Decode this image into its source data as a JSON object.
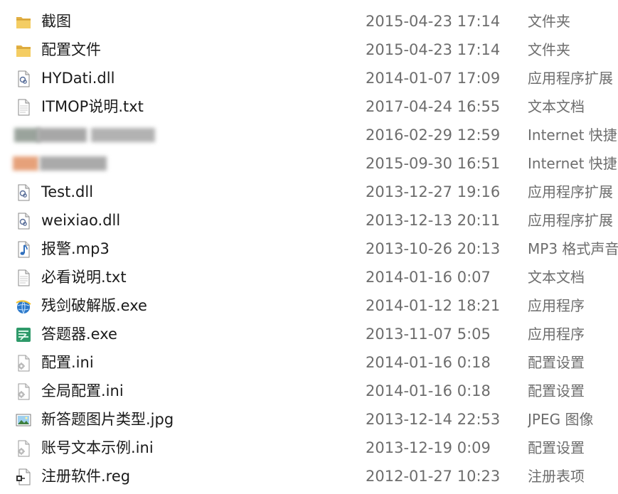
{
  "files": [
    {
      "icon": "folder-icon",
      "name": "截图",
      "date": "2015-04-23 17:14",
      "type": "文件夹"
    },
    {
      "icon": "folder-icon",
      "name": "配置文件",
      "date": "2015-04-23 17:14",
      "type": "文件夹"
    },
    {
      "icon": "dll-file-icon",
      "name": "HYDati.dll",
      "date": "2014-01-07 17:09",
      "type": "应用程序扩展"
    },
    {
      "icon": "text-file-icon",
      "name": "ITMOP说明.txt",
      "date": "2017-04-24 16:55",
      "type": "文本文档"
    },
    {
      "icon": "blurred-icon",
      "name": "",
      "date": "2016-02-29 12:59",
      "type": "Internet 快捷方式"
    },
    {
      "icon": "blurred-icon",
      "name": "",
      "date": "2015-09-30 16:51",
      "type": "Internet 快捷方式"
    },
    {
      "icon": "dll-file-icon",
      "name": "Test.dll",
      "date": "2013-12-27 19:16",
      "type": "应用程序扩展"
    },
    {
      "icon": "dll-file-icon",
      "name": "weixiao.dll",
      "date": "2013-12-13 20:11",
      "type": "应用程序扩展"
    },
    {
      "icon": "audio-file-icon",
      "name": "报警.mp3",
      "date": "2013-10-26 20:13",
      "type": "MP3 格式声音"
    },
    {
      "icon": "text-file-icon",
      "name": "必看说明.txt",
      "date": "2014-01-16 0:07",
      "type": "文本文档"
    },
    {
      "icon": "globe-exe-icon",
      "name": "残剑破解版.exe",
      "date": "2014-01-12 18:21",
      "type": "应用程序"
    },
    {
      "icon": "green-exe-icon",
      "name": "答题器.exe",
      "date": "2013-11-07 5:05",
      "type": "应用程序"
    },
    {
      "icon": "ini-file-icon",
      "name": "配置.ini",
      "date": "2014-01-16 0:18",
      "type": "配置设置"
    },
    {
      "icon": "ini-file-icon",
      "name": "全局配置.ini",
      "date": "2014-01-16 0:18",
      "type": "配置设置"
    },
    {
      "icon": "image-file-icon",
      "name": "新答题图片类型.jpg",
      "date": "2013-12-14 22:53",
      "type": "JPEG 图像"
    },
    {
      "icon": "ini-file-icon",
      "name": "账号文本示例.ini",
      "date": "2013-12-19 0:09",
      "type": "配置设置"
    },
    {
      "icon": "registry-file-icon",
      "name": "注册软件.reg",
      "date": "2012-01-27 10:23",
      "type": "注册表项"
    }
  ],
  "colors": {
    "name_text": "#1a1a1a",
    "meta_text": "#6d6d6d",
    "folder": "#e8b84a"
  }
}
